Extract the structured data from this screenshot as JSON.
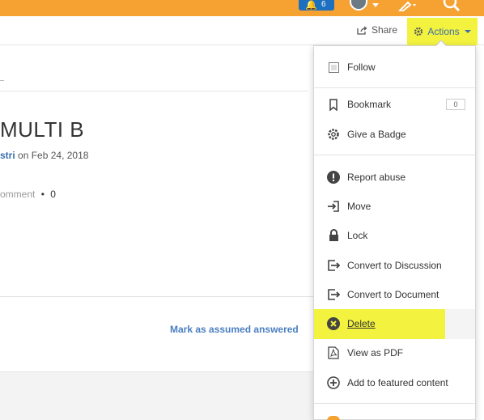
{
  "topbar": {
    "notification_count": "6",
    "icons": [
      "bell-icon",
      "avatar",
      "pen-icon",
      "search-icon"
    ],
    "color": "#f5a233"
  },
  "toolbar": {
    "share_label": "Share",
    "actions_label": "Actions",
    "actions_highlight": "#f2f23f"
  },
  "content": {
    "title": "MULTI B",
    "author": "stri",
    "byline_rest": " on Feb 24, 2018",
    "meta_text": "omment",
    "meta_sep": "•",
    "meta_count": "0",
    "mark_answered": "Mark as assumed answered"
  },
  "menu": {
    "follow": "Follow",
    "bookmark": "Bookmark",
    "bookmark_count": "0",
    "give_badge": "Give a Badge",
    "report_abuse": "Report abuse",
    "move": "Move",
    "lock": "Lock",
    "convert_discussion": "Convert to Discussion",
    "convert_document": "Convert to Document",
    "delete": "Delete",
    "view_pdf": "View as PDF",
    "add_featured": "Add to featured content"
  }
}
